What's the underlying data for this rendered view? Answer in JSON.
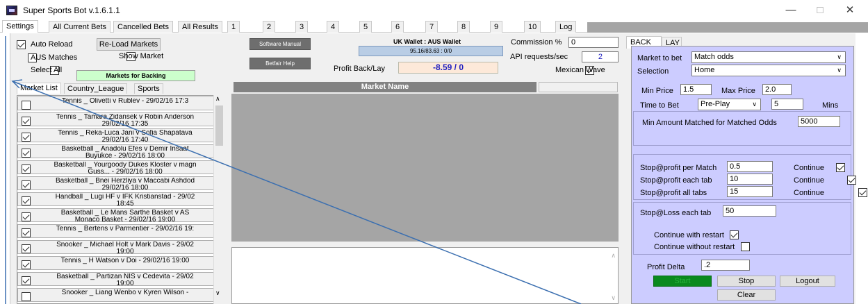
{
  "window": {
    "title": "Super Sports Bot v.1.6.1.1",
    "minimize": "—",
    "maximize": "□",
    "close": "✕"
  },
  "tabs": [
    "Settings",
    "All Current Bets",
    "Cancelled Bets",
    "All Results",
    "1",
    "2",
    "3",
    "4",
    "5",
    "6",
    "7",
    "8",
    "9",
    "10",
    "Log"
  ],
  "settings": {
    "auto_reload": "Auto Reload",
    "reload_markets": "Re-Load Markets",
    "aus_matches": "AUS Matches",
    "show_market": "Show Market",
    "select_all": "Select All",
    "markets_for_backing": "Markets for Backing",
    "software_manual": "Software Manual",
    "betfair_help": "Betfair Help",
    "wallet_title": "UK Wallet : AUS Wallet",
    "wallet_value": "95.16/83.63  :  0/0",
    "profit_label": "Profit Back/Lay",
    "profit_value": "-8.59 / 0",
    "commission_label": "Commission %",
    "commission_value": "0",
    "api_label": "API requests/sec",
    "api_value": "2",
    "mexican_wave": "Mexican Wave"
  },
  "subtabs": [
    "Market List",
    "Country_League",
    "Sports"
  ],
  "market_name_header": "Market Name",
  "markets": [
    {
      "text": "Tennis _ Olivetti v Rublev - 29/02/16 17:3",
      "checked": false
    },
    {
      "text": "Tennis _ Tamara Zidansek v Robin Anderson\n29/02/16 17:35",
      "checked": true
    },
    {
      "text": "Tennis _ Reka-Luca Jani v Sofia Shapatava\n29/02/16 17:40",
      "checked": true
    },
    {
      "text": "Basketball _ Anadolu Efes v Demir Insaat\nBuyukce - 29/02/16 18:00",
      "checked": true
    },
    {
      "text": "Basketball _ Yourgoody Dukes Kloster v magn\nGuss... - 29/02/16 18:00",
      "checked": true
    },
    {
      "text": "Basketball _ Bnei Herzliya v Maccabi Ashdod\n29/02/16 18:00",
      "checked": true
    },
    {
      "text": "Handball _ Lugi HF v IFK Kristianstad - 29/02\n18:45",
      "checked": true
    },
    {
      "text": "Basketball _ Le Mans Sarthe Basket v AS\nMonaco Basket - 29/02/16 19:00",
      "checked": true
    },
    {
      "text": "Tennis _ Bertens v Parmentier - 29/02/16 19:",
      "checked": true
    },
    {
      "text": "Snooker _ Michael Holt v Mark Davis - 29/02\n19:00",
      "checked": true
    },
    {
      "text": "Tennis _ H Watson v Doi - 29/02/16 19:00",
      "checked": true
    },
    {
      "text": "Basketball _ Partizan NIS v Cedevita - 29/02\n19:00",
      "checked": true
    },
    {
      "text": "Snooker _ Liang Wenbo v Kyren Wilson -",
      "checked": false
    }
  ],
  "bet_tabs": [
    "BACK",
    "LAY"
  ],
  "back": {
    "market_to_bet_label": "Market to bet",
    "market_to_bet_value": "Match odds",
    "selection_label": "Selection",
    "selection_value": "Home",
    "min_price_label": "Min Price",
    "min_price_value": "1.5",
    "max_price_label": "Max Price",
    "max_price_value": "2.0",
    "time_to_bet_label": "Time to Bet",
    "time_to_bet_value": "Pre-Play",
    "time_value": "5",
    "mins_label": "Mins",
    "min_amount_label": "Min Amount Matched for Matched Odds",
    "min_amount_value": "5000",
    "stop_profit_match_label": "Stop@profit per Match",
    "stop_profit_match_value": "0.5",
    "stop_profit_tab_label": "Stop@profit each tab",
    "stop_profit_tab_value": "10",
    "stop_profit_all_label": "Stop@profit all tabs",
    "stop_profit_all_value": "15",
    "continue_label": "Continue",
    "stop_loss_label": "Stop@Loss each tab",
    "stop_loss_value": "50",
    "continue_restart": "Continue with restart",
    "continue_no_restart": "Continue without restart",
    "profit_delta_label": "Profit Delta",
    "profit_delta_value": ".2",
    "start": "Start",
    "stop": "Stop",
    "logout": "Logout",
    "clear": "Clear"
  },
  "colors": {
    "purple_panel": "#ccccff",
    "start_green": "#0a8a1e",
    "profit_blue": "#1f1fc0"
  }
}
